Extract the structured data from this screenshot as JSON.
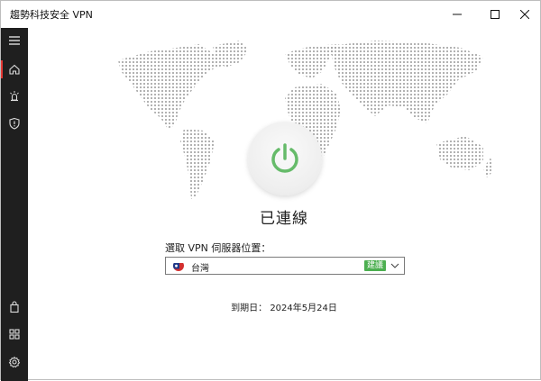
{
  "window": {
    "title": "趨勢科技安全 VPN"
  },
  "titlebar": {
    "minimize_icon": "minimize-icon",
    "maximize_icon": "maximize-icon",
    "close_icon": "close-icon"
  },
  "sidebar": {
    "top": [
      "menu-icon",
      "home-icon",
      "bug-icon",
      "shield-icon"
    ],
    "bottom": [
      "bag-icon",
      "grid-icon",
      "gear-icon"
    ]
  },
  "main": {
    "status": "已連線",
    "select_label": "選取 VPN 伺服器位置：",
    "server": {
      "name": "台灣",
      "badge": "建議"
    },
    "expiry": "到期日： 2024年5月24日"
  },
  "colors": {
    "accent_green": "#4caf50",
    "power_green": "#66bb6a",
    "sidebar_bg": "#1f1f1f",
    "active_marker": "#e53935"
  }
}
